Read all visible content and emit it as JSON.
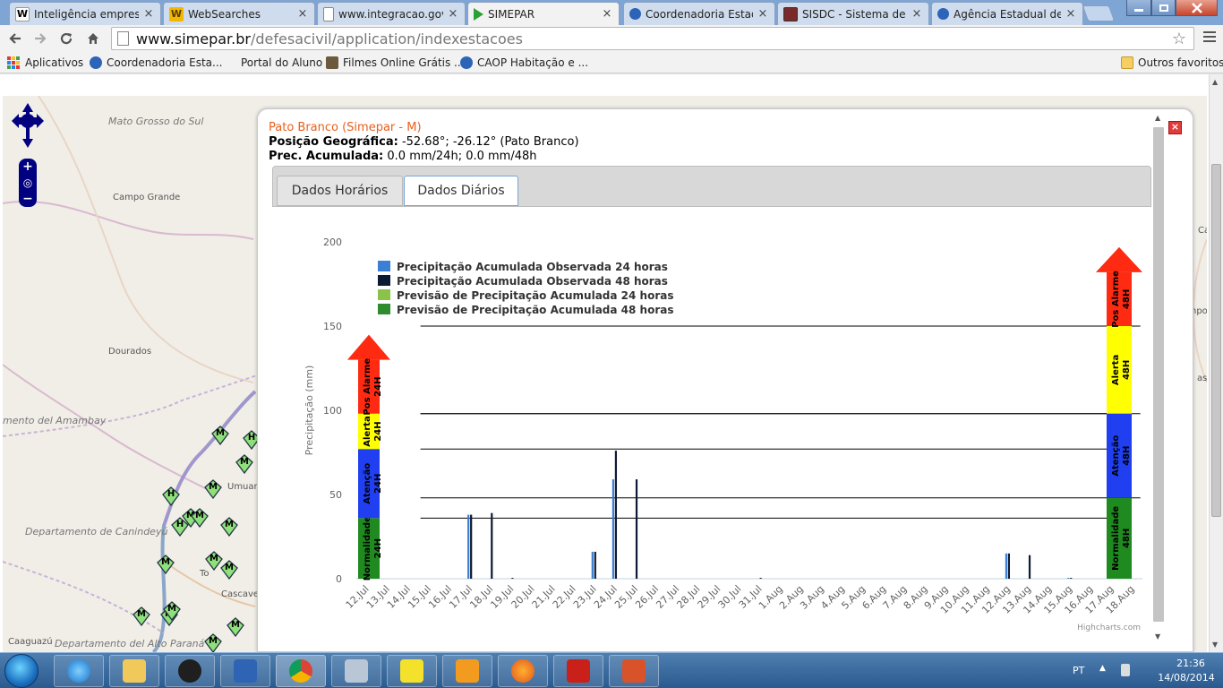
{
  "browser": {
    "tabs": [
      {
        "label": "Inteligência empresari",
        "favicon": "W"
      },
      {
        "label": "WebSearches",
        "favicon": "W"
      },
      {
        "label": "www.integracao.gov.b",
        "favicon": ""
      },
      {
        "label": "SIMEPAR",
        "favicon": ""
      },
      {
        "label": "Coordenadoria Estadu",
        "favicon": ""
      },
      {
        "label": "SISDC - Sistema de De",
        "favicon": ""
      },
      {
        "label": "Agência Estadual de N",
        "favicon": ""
      }
    ],
    "tab_close_glyph": "×",
    "url_host": "www.simepar.br",
    "url_path": "/defesacivil/application/indexestacoes",
    "bookmarks": [
      {
        "label": "Aplicativos"
      },
      {
        "label": "Coordenadoria Esta..."
      },
      {
        "label": "Portal do Aluno"
      },
      {
        "label": "Filmes Online Grátis ..."
      },
      {
        "label": "CAOP Habitação e ..."
      }
    ],
    "other_bookmarks": "Outros favoritos"
  },
  "map": {
    "labels": [
      {
        "text": "Mato Grosso do Sul",
        "kind": "region"
      },
      {
        "text": "Campo Grande",
        "kind": "city"
      },
      {
        "text": "Dourados",
        "kind": "city"
      },
      {
        "text": "mento del Amambay",
        "kind": "region"
      },
      {
        "text": "Departamento de Canindeyú",
        "kind": "region"
      },
      {
        "text": "Departamento del Alto Paraná",
        "kind": "region"
      },
      {
        "text": "Caaguazú",
        "kind": "city"
      },
      {
        "text": "Umuarar",
        "kind": "city"
      },
      {
        "text": "Cascavel",
        "kind": "city"
      },
      {
        "text": "To",
        "kind": "city"
      },
      {
        "text": "Ca",
        "kind": "city"
      },
      {
        "text": "npo",
        "kind": "city"
      },
      {
        "text": "as",
        "kind": "city"
      }
    ],
    "markers": [
      "M",
      "H",
      "M",
      "M",
      "H",
      "M",
      "M",
      "H",
      "M",
      "M",
      "M",
      "M",
      "M",
      "M",
      "M",
      "M",
      "M"
    ],
    "zoom_in": "+",
    "zoom_out": "−"
  },
  "popup": {
    "title": "Pato Branco (Simepar - M)",
    "position_label": "Posição Geográfica:",
    "position_value": " -52.68°; -26.12° (Pato Branco)",
    "prec_label": "Prec. Acumulada:",
    "prec_value": " 0.0 mm/24h; 0.0 mm/48h",
    "close_glyph": "×",
    "tabs": [
      {
        "label": "Dados Horários",
        "active": false
      },
      {
        "label": "Dados Diários",
        "active": true
      }
    ]
  },
  "chart_data": {
    "type": "bar",
    "ylabel": "Precipitação (mm)",
    "ylim": [
      0,
      200
    ],
    "yticks": [
      0,
      50,
      100,
      150,
      200
    ],
    "credits": "Highcharts.com",
    "categories": [
      "12.Jul",
      "13.Jul",
      "14.Jul",
      "15.Jul",
      "16.Jul",
      "17.Jul",
      "18.Jul",
      "19.Jul",
      "20.Jul",
      "21.Jul",
      "22.Jul",
      "23.Jul",
      "24.Jul",
      "25.Jul",
      "26.Jul",
      "27.Jul",
      "28.Jul",
      "29.Jul",
      "30.Jul",
      "31.Jul",
      "1.Aug",
      "2.Aug",
      "3.Aug",
      "4.Aug",
      "5.Aug",
      "6.Aug",
      "7.Aug",
      "8.Aug",
      "9.Aug",
      "10.Aug",
      "11.Aug",
      "12.Aug",
      "13.Aug",
      "14.Aug",
      "15.Aug",
      "16.Aug",
      "17.Aug",
      "18.Aug"
    ],
    "series": [
      {
        "name": "Precipitação Acumulada Observada 24 horas",
        "color": "#3a7fd5",
        "values": [
          0,
          0,
          0,
          0,
          0,
          38,
          0,
          0,
          0,
          0,
          0,
          16,
          59,
          0,
          0,
          0,
          0,
          0,
          0,
          0,
          0,
          0,
          0,
          0,
          0,
          0,
          0,
          0,
          0,
          0,
          0,
          15,
          0,
          0,
          0.5,
          0,
          0,
          0
        ]
      },
      {
        "name": "Precipitação Acumulada Observada 48 horas",
        "color": "#0d1a33",
        "values": [
          0,
          0,
          0,
          0,
          0,
          38,
          39,
          0.5,
          0,
          0,
          0,
          16,
          76,
          59,
          0,
          0,
          0,
          0,
          0,
          0.5,
          0,
          0,
          0,
          0,
          0,
          0,
          0,
          0,
          0,
          0,
          0,
          15,
          14,
          0,
          0.5,
          0,
          0,
          0
        ]
      },
      {
        "name": "Previsão de Precipitação Acumulada 24 horas",
        "color": "#8bc34a",
        "values": [
          0,
          0,
          0,
          0,
          0,
          0,
          0,
          0,
          0,
          0,
          0,
          0,
          0,
          0,
          0,
          0,
          0,
          0,
          0,
          0,
          0,
          0,
          0,
          0,
          0,
          0,
          0,
          0,
          0,
          0,
          0,
          0,
          0,
          0,
          0,
          0,
          0,
          0
        ]
      },
      {
        "name": "Previsão de Precipitação Acumulada 48 horas",
        "color": "#2e8b2e",
        "values": [
          0,
          0,
          0,
          0,
          0,
          0,
          0,
          0,
          0,
          0,
          0,
          0,
          0,
          0,
          0,
          0,
          0,
          0,
          0,
          0,
          0,
          0,
          0,
          0,
          0,
          0,
          0,
          0,
          0,
          0,
          0,
          0,
          0,
          0,
          0,
          0,
          0,
          0
        ]
      }
    ],
    "thresholds_24h": [
      36,
      77,
      98
    ],
    "thresholds_48h": [
      48,
      98,
      150
    ],
    "bands_24h": [
      {
        "label": "Normalidade",
        "sub": "24H",
        "from": 0,
        "to": 36,
        "color": "#1f8a1f"
      },
      {
        "label": "Atenção",
        "sub": "24H",
        "from": 36,
        "to": 77,
        "color": "#1f3ff0"
      },
      {
        "label": "Alerta",
        "sub": "24H",
        "from": 77,
        "to": 98,
        "color": "#ffff00"
      },
      {
        "label": "Pos Alarme",
        "sub": "24H",
        "from": 98,
        "to": 130,
        "color": "#ff2a12"
      }
    ],
    "bands_48h": [
      {
        "label": "Normalidade",
        "sub": "48H",
        "from": 0,
        "to": 48,
        "color": "#1f8a1f"
      },
      {
        "label": "Atenção",
        "sub": "48H",
        "from": 48,
        "to": 98,
        "color": "#1f3ff0"
      },
      {
        "label": "Alerta",
        "sub": "48H",
        "from": 98,
        "to": 150,
        "color": "#ffff00"
      },
      {
        "label": "Pos Alarme",
        "sub": "48H",
        "from": 150,
        "to": 182,
        "color": "#ff2a12"
      }
    ]
  },
  "taskbar": {
    "language": "PT",
    "time": "21:36",
    "date": "14/08/2014"
  }
}
